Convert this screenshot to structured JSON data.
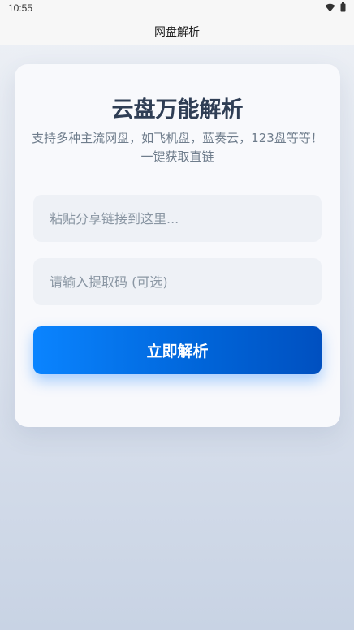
{
  "status_bar": {
    "time": "10:55",
    "icons": [
      "wifi-icon",
      "battery-icon"
    ]
  },
  "app_bar": {
    "title": "网盘解析"
  },
  "card": {
    "title": "云盘万能解析",
    "subtitle": "支持多种主流网盘，如飞机盘，蓝奏云，123盘等等！一键获取直链",
    "link_input": {
      "value": "",
      "placeholder": "粘贴分享链接到这里..."
    },
    "code_input": {
      "value": "",
      "placeholder": "请输入提取码 (可选)"
    },
    "parse_button_label": "立即解析"
  },
  "colors": {
    "accent": "#0a84ff",
    "title_text": "#2f3e55",
    "subtitle_text": "#6f7d8c",
    "input_bg": "#eef1f6"
  }
}
